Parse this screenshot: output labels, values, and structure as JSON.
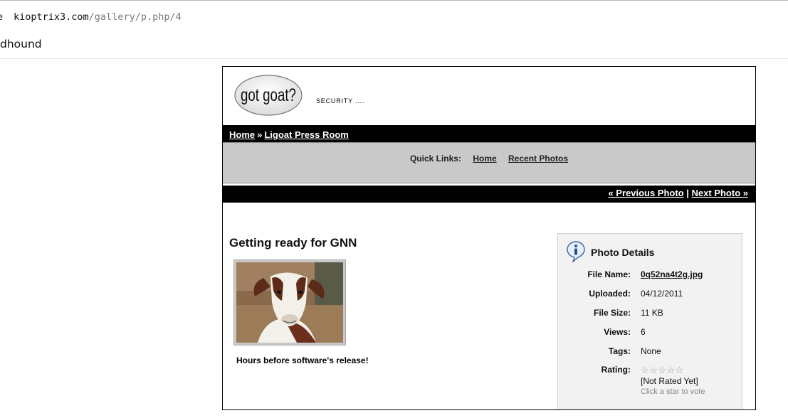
{
  "browser": {
    "url_lead": "e",
    "url_host": "kioptrix3.com",
    "url_path": "/gallery/p.php/4",
    "bookmark": "dhound"
  },
  "header": {
    "logo_text": "got goat?",
    "tagline": "SECURITY ...."
  },
  "breadcrumb": {
    "home": "Home",
    "separator": "»",
    "current": "Ligoat Press Room"
  },
  "quick_links": {
    "label": "Quick Links:",
    "items": [
      "Home",
      "Recent Photos"
    ]
  },
  "photo_nav": {
    "previous": "« Previous Photo",
    "separator": "|",
    "next": "Next Photo »"
  },
  "photo": {
    "title": "Getting ready for GNN",
    "caption": "Hours before software's release!"
  },
  "details": {
    "heading": "Photo Details",
    "rows": [
      {
        "label": "File Name:",
        "value": "0q52na4t2g.jpg"
      },
      {
        "label": "Uploaded:",
        "value": "04/12/2011"
      },
      {
        "label": "File Size:",
        "value": "11 KB"
      },
      {
        "label": "Views:",
        "value": "6"
      },
      {
        "label": "Tags:",
        "value": "None"
      }
    ],
    "rating_label": "Rating:",
    "stars": "☆☆☆☆☆",
    "rating_status": "[Not Rated Yet]",
    "vote_hint": "Click a star to vote"
  },
  "colors": {
    "bar": "#000000",
    "quicklinks_bg": "#c9c9c9",
    "details_bg": "#f2f2f2",
    "hint_text": "#888888"
  },
  "icons": [
    "info-icon",
    "star-icon"
  ]
}
